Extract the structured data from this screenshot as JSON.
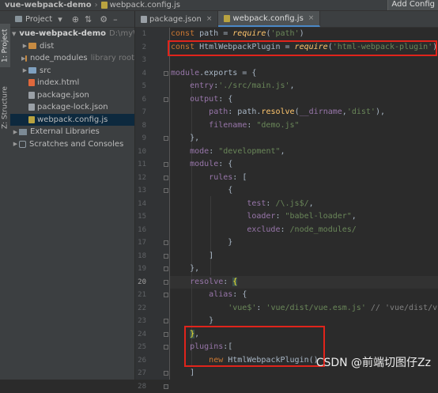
{
  "breadcrumb": {
    "project": "vue-webpack-demo",
    "file": "webpack.config.js"
  },
  "toolbar": {
    "add_config": "Add Config"
  },
  "tool_strip": {
    "project_tab": "1: Project",
    "structure_tab": "Z: Structure"
  },
  "project_panel": {
    "title": "Project",
    "tree": [
      {
        "label": "vue-webpack-demo",
        "hint": "D:\\myW",
        "type": "root"
      },
      {
        "label": "dist",
        "type": "folder-orange"
      },
      {
        "label": "node_modules",
        "hint": "library root",
        "type": "folder-orange"
      },
      {
        "label": "src",
        "type": "folder"
      },
      {
        "label": "index.html",
        "type": "html"
      },
      {
        "label": "package.json",
        "type": "json"
      },
      {
        "label": "package-lock.json",
        "type": "json"
      },
      {
        "label": "webpack.config.js",
        "type": "js",
        "selected": true
      },
      {
        "label": "External Libraries",
        "type": "lib"
      },
      {
        "label": "Scratches and Consoles",
        "type": "scratch"
      }
    ]
  },
  "editor_tabs": [
    {
      "label": "package.json",
      "active": false
    },
    {
      "label": "webpack.config.js",
      "active": true
    }
  ],
  "code": {
    "current_line": 20,
    "lines": [
      [
        [
          "kw",
          "const "
        ],
        [
          "id",
          "path = "
        ],
        [
          "fn",
          "require"
        ],
        [
          "id",
          "("
        ],
        [
          "str",
          "'path'"
        ],
        [
          "id",
          ")"
        ]
      ],
      [
        [
          "kw",
          "const "
        ],
        [
          "id",
          "HtmlWebpackPlugin = "
        ],
        [
          "fn",
          "require"
        ],
        [
          "id",
          "("
        ],
        [
          "str",
          "'html-webpack-plugin'"
        ],
        [
          "id",
          ")"
        ]
      ],
      [],
      [
        [
          "prop",
          "module"
        ],
        [
          "id",
          ".exports = {"
        ]
      ],
      [
        [
          "id",
          "    "
        ],
        [
          "prop",
          "entry"
        ],
        [
          "id",
          ":"
        ],
        [
          "str",
          "'./src/main.js'"
        ],
        [
          "id",
          ","
        ]
      ],
      [
        [
          "id",
          "    "
        ],
        [
          "prop",
          "output"
        ],
        [
          "id",
          ": {"
        ]
      ],
      [
        [
          "id",
          "        "
        ],
        [
          "prop",
          "path"
        ],
        [
          "id",
          ": path."
        ],
        [
          "method",
          "resolve"
        ],
        [
          "id",
          "("
        ],
        [
          "prop",
          "__dirname"
        ],
        [
          "id",
          ","
        ],
        [
          "str",
          "'dist'"
        ],
        [
          "id",
          "),"
        ]
      ],
      [
        [
          "id",
          "        "
        ],
        [
          "prop",
          "filename"
        ],
        [
          "id",
          ": "
        ],
        [
          "str",
          "\"demo.js\""
        ]
      ],
      [
        [
          "id",
          "    },"
        ]
      ],
      [
        [
          "id",
          "    "
        ],
        [
          "prop",
          "mode"
        ],
        [
          "id",
          ": "
        ],
        [
          "str",
          "\"development\""
        ],
        [
          "id",
          ","
        ]
      ],
      [
        [
          "id",
          "    "
        ],
        [
          "prop",
          "module"
        ],
        [
          "id",
          ": {"
        ]
      ],
      [
        [
          "id",
          "        "
        ],
        [
          "prop",
          "rules"
        ],
        [
          "id",
          ": ["
        ]
      ],
      [
        [
          "id",
          "            {"
        ]
      ],
      [
        [
          "id",
          "                "
        ],
        [
          "prop",
          "test"
        ],
        [
          "id",
          ": "
        ],
        [
          "regex",
          "/\\.js$/"
        ],
        [
          "id",
          ","
        ]
      ],
      [
        [
          "id",
          "                "
        ],
        [
          "prop",
          "loader"
        ],
        [
          "id",
          ": "
        ],
        [
          "str",
          "\"babel-loader\""
        ],
        [
          "id",
          ","
        ]
      ],
      [
        [
          "id",
          "                "
        ],
        [
          "prop",
          "exclude"
        ],
        [
          "id",
          ": "
        ],
        [
          "regex",
          "/node_modules/"
        ]
      ],
      [
        [
          "id",
          "            }"
        ]
      ],
      [
        [
          "id",
          "        ]"
        ]
      ],
      [
        [
          "id",
          "    },"
        ]
      ],
      [
        [
          "id",
          "    "
        ],
        [
          "prop",
          "resolve"
        ],
        [
          "id",
          ": "
        ],
        [
          "brace",
          "{"
        ]
      ],
      [
        [
          "id",
          "        "
        ],
        [
          "prop",
          "alias"
        ],
        [
          "id",
          ": {"
        ]
      ],
      [
        [
          "id",
          "            "
        ],
        [
          "str",
          "'vue$'"
        ],
        [
          "id",
          ": "
        ],
        [
          "str",
          "'vue/dist/vue.esm.js'"
        ],
        [
          "id",
          " "
        ],
        [
          "cmt",
          "// 'vue/dist/vue"
        ]
      ],
      [
        [
          "id",
          "        }"
        ]
      ],
      [
        [
          "id",
          "    "
        ],
        [
          "brace",
          "}"
        ],
        [
          "id",
          ","
        ]
      ],
      [
        [
          "id",
          "    "
        ],
        [
          "prop",
          "plugins"
        ],
        [
          "id",
          ":["
        ]
      ],
      [
        [
          "id",
          "        "
        ],
        [
          "kw",
          "new "
        ],
        [
          "cls",
          "HtmlWebpackPlugin()"
        ]
      ],
      [
        [
          "id",
          "    ]"
        ]
      ],
      [
        [
          "id",
          "}"
        ]
      ]
    ]
  },
  "watermark": "CSDN @前端切图仔Zz"
}
